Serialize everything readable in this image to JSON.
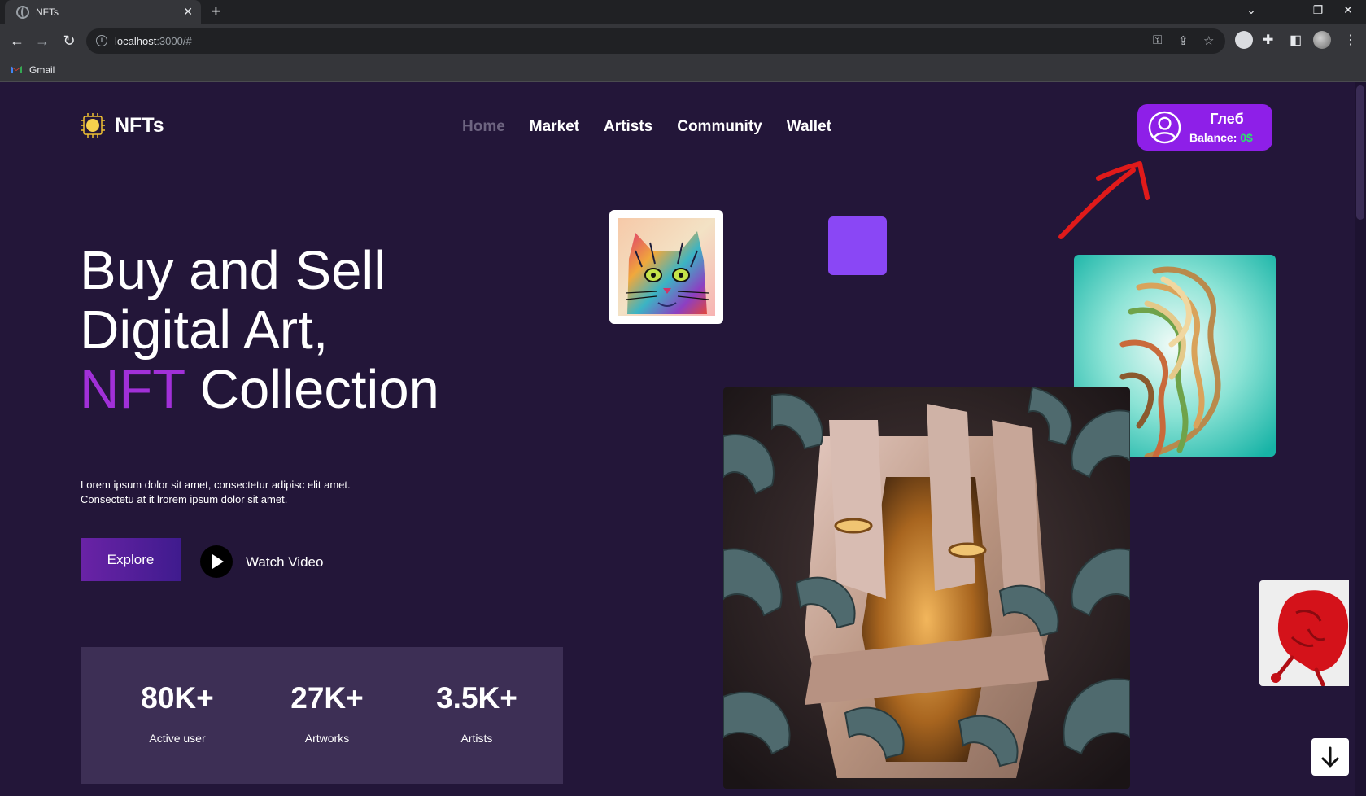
{
  "browser": {
    "tab_title": "NFTs",
    "tab_close": "✕",
    "new_tab": "+",
    "url_host": "localhost",
    "url_rest": ":3000/#",
    "bookmark_gmail": "Gmail"
  },
  "header": {
    "brand": "NFTs",
    "nav": [
      "Home",
      "Market",
      "Artists",
      "Community",
      "Wallet"
    ],
    "active_nav": "Home"
  },
  "user": {
    "name": "Глеб",
    "balance_label": "Balance:",
    "balance_value": "0$",
    "balance_color": "#2be36d"
  },
  "hero": {
    "title_line1": "Buy and Sell",
    "title_line2": "Digital Art,",
    "title_accent": "NFT",
    "title_rest": " Collection",
    "description_line1": "Lorem ipsum dolor sit amet, consectetur adipisc elit amet.",
    "description_line2": "Consectetu at it lrorem ipsum dolor sit amet.",
    "explore_label": "Explore",
    "watch_label": "Watch Video"
  },
  "stats": [
    {
      "value": "80K+",
      "label": "Active user"
    },
    {
      "value": "27K+",
      "label": "Artworks"
    },
    {
      "value": "3.5K+",
      "label": "Artists"
    }
  ],
  "colors": {
    "page_bg": "#231639",
    "accent": "#a130d8",
    "user_button": "#8e1fe8",
    "stats_panel": "#3d2f55"
  },
  "icons": {
    "logo": "sun-chip-icon",
    "user": "user-circle-icon",
    "play": "play-icon",
    "scroll_down": "arrow-down-icon"
  }
}
